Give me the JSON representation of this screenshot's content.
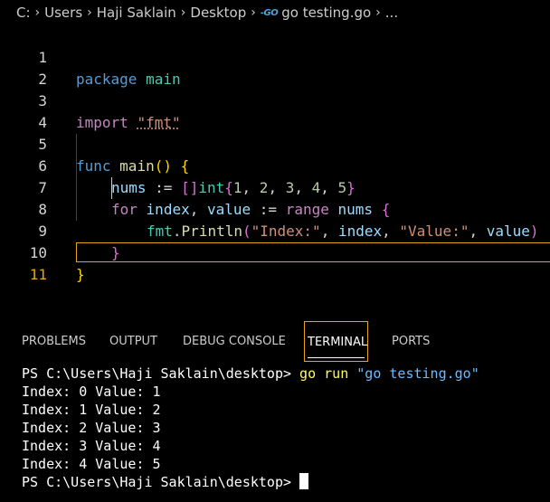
{
  "breadcrumb": {
    "items": [
      "C:",
      "Users",
      "Haji Saklain",
      "Desktop"
    ],
    "file_icon": "go-file-icon",
    "file_icon_text": "-GO",
    "file_name": "go testing.go",
    "more": "..."
  },
  "editor": {
    "line_numbers": [
      "1",
      "2",
      "3",
      "4",
      "5",
      "6",
      "7",
      "8",
      "9",
      "10",
      "11"
    ],
    "active_line": "11",
    "code": {
      "l1_kw": "package",
      "l1_name": "main",
      "l3_kw": "import",
      "l3_str": "\"fmt\"",
      "l5_kw": "func",
      "l5_fn": "main",
      "l5_parens": "()",
      "l5_brace": "{",
      "l6_var": "nums",
      "l6_op": ":=",
      "l6_brackets": "[]",
      "l6_type": "int",
      "l6_open": "{",
      "l6_nums": [
        "1",
        "2",
        "3",
        "4",
        "5"
      ],
      "l6_close": "}",
      "l7_for": "for",
      "l7_index": "index",
      "l7_value": "value",
      "l7_op": ":=",
      "l7_range": "range",
      "l7_nums": "nums",
      "l7_brace": "{",
      "l8_pkg": "fmt",
      "l8_fn": "Println",
      "l8_str1": "\"Index:\"",
      "l8_index": "index",
      "l8_str2": "\"Value:\"",
      "l8_value": "value",
      "l9_brace": "}",
      "l10_brace": "}"
    }
  },
  "panel": {
    "tabs": [
      "PROBLEMS",
      "OUTPUT",
      "DEBUG CONSOLE",
      "TERMINAL",
      "PORTS"
    ],
    "active_tab": "TERMINAL"
  },
  "terminal": {
    "prompt": "PS C:\\Users\\Haji Saklain\\desktop>",
    "command": "go",
    "command_args": "run",
    "command_file": "\"go testing.go\"",
    "output_lines": [
      "Index: 0 Value: 1",
      "Index: 1 Value: 2",
      "Index: 2 Value: 3",
      "Index: 3 Value: 4",
      "Index: 4 Value: 5"
    ],
    "final_prompt": "PS C:\\Users\\Haji Saklain\\desktop>"
  },
  "colors": {
    "background": "#000000",
    "accent": "#e8a317",
    "keyword": "#569cd6",
    "control_keyword": "#c586c0",
    "string": "#ce9178",
    "function": "#dcdcaa",
    "variable": "#9cdcfe",
    "type": "#4ec9b0",
    "number": "#b5cea8"
  }
}
